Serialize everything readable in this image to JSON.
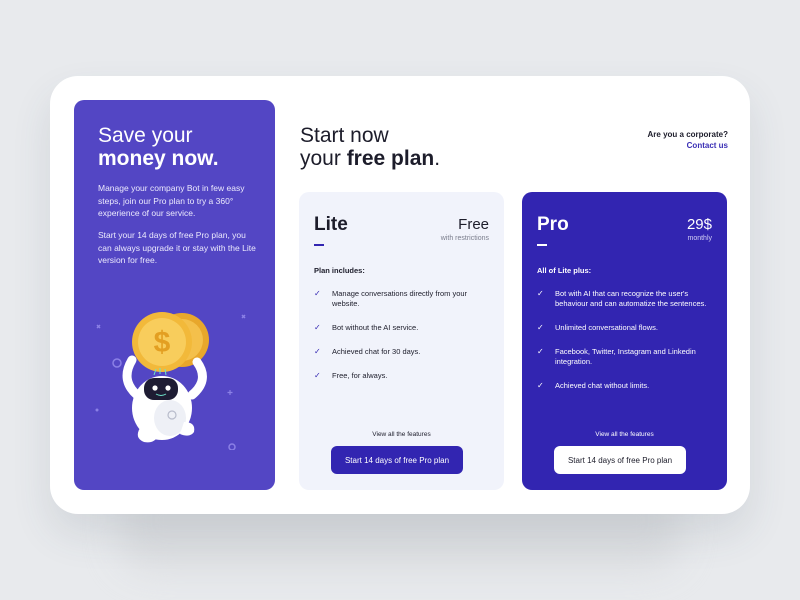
{
  "colors": {
    "promo_bg": "#5346c4",
    "pro_bg": "#3225b1",
    "lite_bg": "#f1f3fb",
    "accent": "#3225b1"
  },
  "promo": {
    "title_light": "Save your",
    "title_bold": "money now.",
    "paragraph_1": "Manage your company Bot in few easy steps, join our Pro plan to try a 360° experience of our service.",
    "paragraph_2": "Start your 14 days of free Pro plan, you can always upgrade it or stay with the Lite version for free.",
    "illustration_icon": "robot-holding-dollar-coins"
  },
  "header": {
    "title_line1": "Start now",
    "title_line2_prefix": "your ",
    "title_line2_bold": "free plan",
    "title_line2_suffix": "."
  },
  "corporate": {
    "question": "Are you a corporate?",
    "link": "Contact us"
  },
  "plans": [
    {
      "name": "Lite",
      "price": "Free",
      "note": "with restrictions",
      "includes_label": "Plan includes:",
      "features": [
        "Manage conversations directly from your website.",
        "Bot without the AI service.",
        "Achieved chat for 30 days.",
        "Free, for always."
      ],
      "view_all": "View all the features",
      "cta": "Start 14 days of free Pro plan"
    },
    {
      "name": "Pro",
      "price": "29$",
      "note": "monthly",
      "includes_label": "All of Lite plus:",
      "features": [
        "Bot with AI that can recognize the user's behaviour and can automatize the sentences.",
        "Unlimited conversational flows.",
        "Facebook, Twitter, Instagram and Linkedin integration.",
        "Achieved chat without limits."
      ],
      "view_all": "View all the features",
      "cta": "Start 14 days of free Pro plan"
    }
  ]
}
